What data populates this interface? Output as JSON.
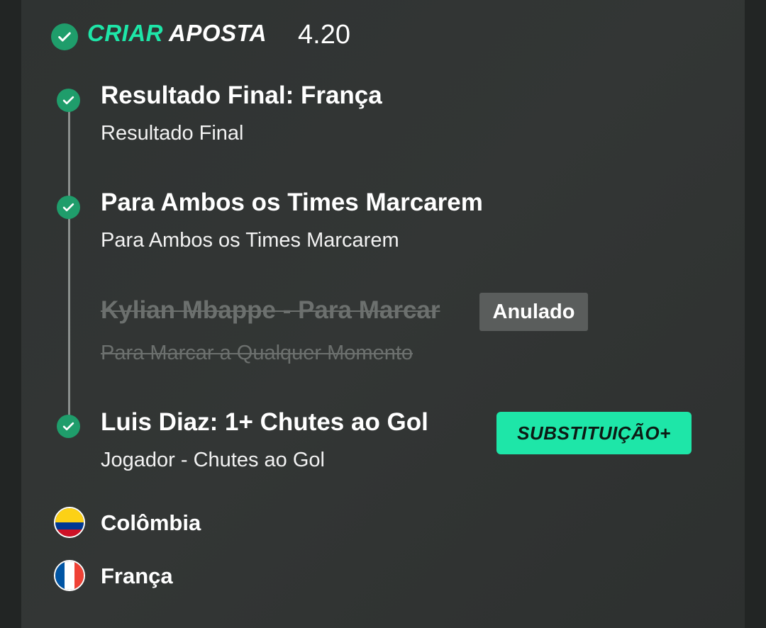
{
  "header": {
    "title_part1": "CRIAR",
    "title_part2": "APOSTA",
    "odds": "4.20"
  },
  "legs": [
    {
      "title": "Resultado Final: França",
      "subtitle": "Resultado Final",
      "status": "won"
    },
    {
      "title": "Para Ambos os Times Marcarem",
      "subtitle": "Para Ambos os Times Marcarem",
      "status": "won"
    },
    {
      "title": "Kylian Mbappe - Para Marcar",
      "subtitle": "Para Marcar a Qualquer Momento",
      "status": "void",
      "badge": "Anulado"
    },
    {
      "title": "Luis Diaz: 1+ Chutes ao Gol",
      "subtitle": "Jogador - Chutes ao Gol",
      "status": "won",
      "badge": "SUBSTITUIÇÃO+"
    }
  ],
  "teams": [
    {
      "name": "Colômbia",
      "flag": "colombia-flag-icon"
    },
    {
      "name": "França",
      "flag": "france-flag-icon"
    }
  ],
  "colors": {
    "accent": "#1ee6a8",
    "check": "#1f9d6b",
    "void_badge": "#5a5d5c",
    "card_bg": "#323534"
  }
}
